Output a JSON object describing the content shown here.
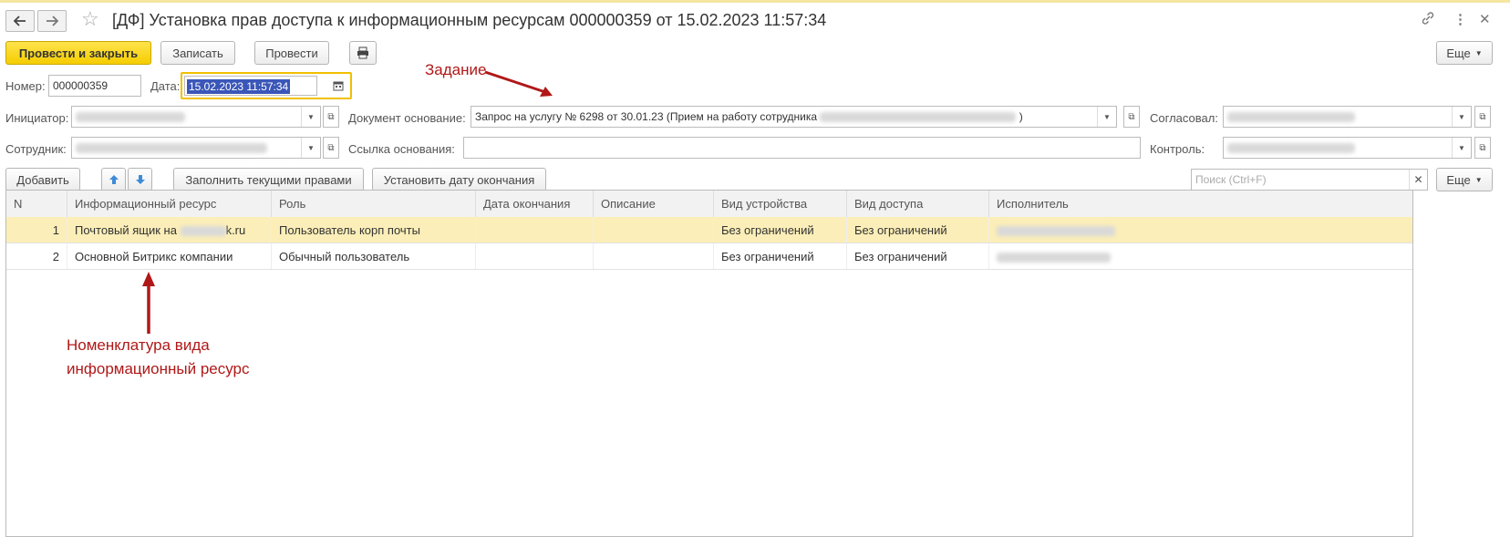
{
  "window": {
    "title": "[ДФ] Установка прав доступа к информационным ресурсам 000000359 от 15.02.2023 11:57:34"
  },
  "toolbar": {
    "post_close_label": "Провести и закрыть",
    "save_label": "Записать",
    "post_label": "Провести",
    "more_label": "Еще"
  },
  "form": {
    "number_label": "Номер:",
    "number_value": "000000359",
    "date_label": "Дата:",
    "date_value": "15.02.2023 11:57:34",
    "initiator_label": "Инициатор:",
    "employee_label": "Сотрудник:",
    "base_doc_label": "Документ основание:",
    "base_doc_value": "Запрос на услугу № 6298 от 30.01.23 (Прием на работу сотрудника",
    "base_doc_close": ")",
    "base_link_label": "Ссылка основания:",
    "approved_label": "Согласовал:",
    "control_label": "Контроль:"
  },
  "table_toolbar": {
    "add_label": "Добавить",
    "fill_label": "Заполнить текущими правами",
    "set_date_label": "Установить дату окончания",
    "search_placeholder": "Поиск (Ctrl+F)",
    "more_label": "Еще"
  },
  "table": {
    "columns": [
      "N",
      "Информационный ресурс",
      "Роль",
      "Дата окончания",
      "Описание",
      "Вид устройства",
      "Вид доступа",
      "Исполнитель"
    ],
    "rows": [
      {
        "n": "1",
        "resource_prefix": "Почтовый ящик на",
        "resource_suffix": "k.ru",
        "role": "Пользователь корп почты",
        "end_date": "",
        "description": "",
        "device": "Без ограничений",
        "access": "Без ограничений"
      },
      {
        "n": "2",
        "resource": "Основной Битрикс компании",
        "role": "Обычный пользователь",
        "end_date": "",
        "description": "",
        "device": "Без ограничений",
        "access": "Без ограничений"
      }
    ]
  },
  "annotations": {
    "task": "Задание",
    "nomenclature_line1": "Номенклатура вида",
    "nomenclature_line2": "информационный ресурс"
  },
  "colors": {
    "primary_button": "#f5cd00",
    "selected_row": "#fbeeb8",
    "annotation": "#b01818",
    "date_highlight": "#3a56b8"
  }
}
